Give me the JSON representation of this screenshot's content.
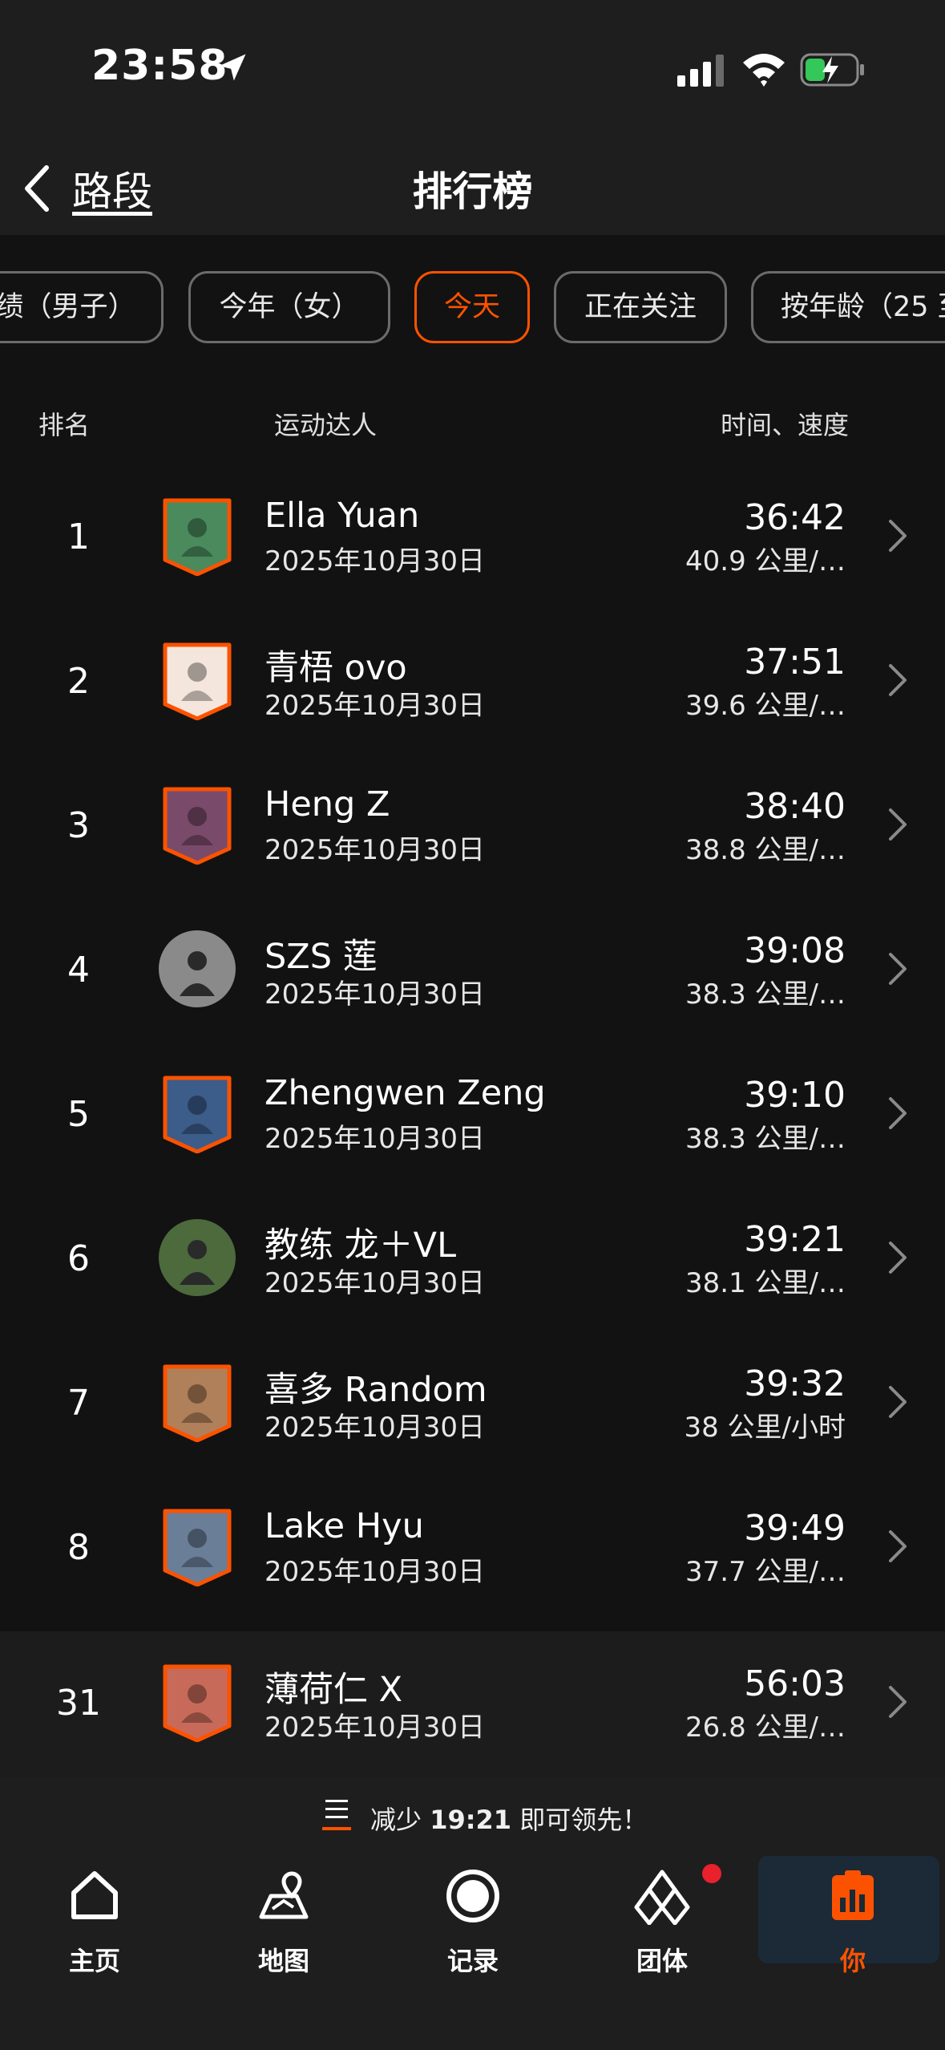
{
  "status_bar": {
    "time": "23:58"
  },
  "nav": {
    "back_label": "路段",
    "title": "排行榜"
  },
  "chips": [
    {
      "label": "绩（男子）",
      "active": false
    },
    {
      "label": "今年（女）",
      "active": false
    },
    {
      "label": "今天",
      "active": true
    },
    {
      "label": "正在关注",
      "active": false
    },
    {
      "label": "按年龄（25 至",
      "active": false
    }
  ],
  "table_header": {
    "rank": "排名",
    "athlete": "运动达人",
    "time": "时间、速度"
  },
  "rows": [
    {
      "rank": "1",
      "name": "Ella Yuan",
      "date": "2025年10月30日",
      "time": "36:42",
      "speed": "40.9 公里/…",
      "avatar": "shield-avatar-cyclist-green",
      "color": "#4a8a5c"
    },
    {
      "rank": "2",
      "name": "青梧 ovo",
      "date": "2025年10月30日",
      "time": "37:51",
      "speed": "39.6 公里/…",
      "avatar": "shield-avatar-cartoon-girl",
      "color": "#f4e6dc"
    },
    {
      "rank": "3",
      "name": "Heng Z",
      "date": "2025年10月30日",
      "time": "38:40",
      "speed": "38.8 公里/…",
      "avatar": "shield-avatar-cartoon",
      "color": "#7a4a6a"
    },
    {
      "rank": "4",
      "name": "SZS 莲",
      "date": "2025年10月30日",
      "time": "39:08",
      "speed": "38.3 公里/…",
      "avatar": "round-avatar-photo",
      "color": "#8a8a8a"
    },
    {
      "rank": "5",
      "name": "Zhengwen Zeng",
      "date": "2025年10月30日",
      "time": "39:10",
      "speed": "38.3 公里/…",
      "avatar": "shield-avatar-cyclist-red",
      "color": "#3c5c8a"
    },
    {
      "rank": "6",
      "name": "教练 龙＋VL",
      "date": "2025年10月30日",
      "time": "39:21",
      "speed": "38.1 公里/…",
      "avatar": "round-avatar-cyclist",
      "color": "#4c6a3c"
    },
    {
      "rank": "7",
      "name": "喜多 Random",
      "date": "2025年10月30日",
      "time": "39:32",
      "speed": "38 公里/小时",
      "avatar": "shield-avatar-sunset",
      "color": "#b0805a"
    },
    {
      "rank": "8",
      "name": "Lake Hyu",
      "date": "2025年10月30日",
      "time": "39:49",
      "speed": "37.7 公里/…",
      "avatar": "shield-avatar-mountain",
      "color": "#6a7e98"
    },
    {
      "rank": "31",
      "name": "薄荷仁 X",
      "date": "2025年10月30日",
      "time": "56:03",
      "speed": "26.8 公里/…",
      "avatar": "shield-avatar-cartoon-rider",
      "color": "#c86a5a"
    }
  ],
  "promo": {
    "prefix": "减少 ",
    "highlight": "19:21",
    "suffix": " 即可领先！"
  },
  "tabs": [
    {
      "label": "主页",
      "icon": "home-icon"
    },
    {
      "label": "地图",
      "icon": "map-icon"
    },
    {
      "label": "记录",
      "icon": "record-icon"
    },
    {
      "label": "团体",
      "icon": "groups-icon"
    },
    {
      "label": "你",
      "icon": "you-icon"
    }
  ],
  "colors": {
    "accent": "#fc5200",
    "background": "#121212",
    "bar": "#1e1e1e",
    "notification": "#e8212c"
  }
}
